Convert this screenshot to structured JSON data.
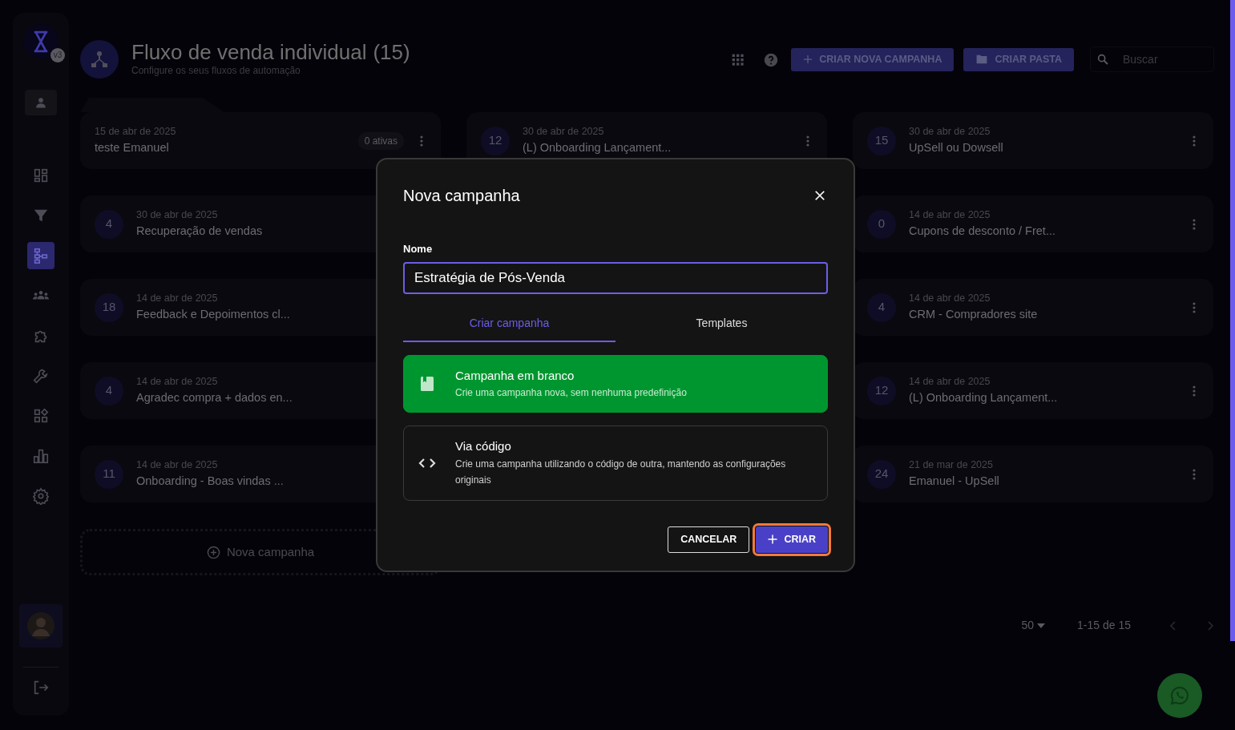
{
  "sidebar": {
    "logo_badge": "v3",
    "items": [
      {
        "selected": false
      },
      {
        "selected": false
      },
      {
        "selected": true
      },
      {
        "selected": false
      },
      {
        "selected": false
      },
      {
        "selected": false
      },
      {
        "selected": false
      },
      {
        "selected": false
      },
      {
        "selected": false
      }
    ]
  },
  "header": {
    "title": "Fluxo de venda individual",
    "count": "(15)",
    "subtitle": "Configure os seus fluxos de automação"
  },
  "toolbar": {
    "buttons": [
      {
        "kind": "create",
        "label": "CRIAR NOVA CAMPANHA"
      },
      {
        "kind": "folder",
        "label": "CRIAR PASTA"
      }
    ],
    "search": {
      "placeholder": "Buscar"
    }
  },
  "columns": [
    {
      "cards": [
        {
          "kind": "folder",
          "date": "15 de abr de 2025",
          "title": "teste Emanuel",
          "badge": "0 ativas",
          "menu": true
        },
        {
          "kind": "campaign",
          "count": "4",
          "date": "30 de abr de 2025",
          "title": "Recuperação de vendas"
        },
        {
          "kind": "campaign",
          "count": "18",
          "date": "14 de abr de 2025",
          "title": "Feedback e Depoimentos cl..."
        },
        {
          "kind": "campaign",
          "count": "4",
          "date": "14 de abr de 2025",
          "title": "Agradec compra + dados en..."
        },
        {
          "kind": "campaign",
          "count": "11",
          "date": "14 de abr de 2025",
          "title": "Onboarding - Boas vindas ..."
        }
      ]
    },
    {
      "cards": [
        {
          "kind": "campaign",
          "count": "12",
          "date": "30 de abr de 2025",
          "title": "(L) Onboarding Lançament...",
          "menu": true
        }
      ]
    },
    {
      "cards": [
        {
          "kind": "campaign",
          "count": "15",
          "date": "30 de abr de 2025",
          "title": "UpSell ou Dowsell",
          "menu": true
        },
        {
          "kind": "campaign",
          "count": "0",
          "date": "14 de abr de 2025",
          "title": "Cupons de desconto / Fret...",
          "menu": true
        },
        {
          "kind": "campaign",
          "count": "4",
          "date": "14 de abr de 2025",
          "title": "CRM - Compradores site",
          "menu": true
        },
        {
          "kind": "campaign",
          "count": "12",
          "date": "14 de abr de 2025",
          "title": "(L) Onboarding Lançament...",
          "menu": true
        },
        {
          "kind": "campaign",
          "count": "24",
          "date": "21 de mar de 2025",
          "title": "Emanuel - UpSell",
          "menu": true
        }
      ]
    }
  ],
  "new_campaign": "Nova campanha",
  "pagination": {
    "page_size": "50",
    "range": "1-15 de 15"
  },
  "modal": {
    "title": "Nova campanha",
    "field": {
      "label": "Nome",
      "value": "Estratégia de Pós-Venda"
    },
    "tabs": [
      {
        "label": "Criar campanha",
        "selected": true
      },
      {
        "label": "Templates",
        "selected": false
      }
    ],
    "options": [
      {
        "kind": "blank",
        "title": "Campanha em branco",
        "description": "Crie uma campanha nova, sem nenhuma predefinição",
        "selected": true
      },
      {
        "kind": "code",
        "title": "Via código",
        "description": "Crie uma campanha utilizando o código de outra, mantendo as configurações originais",
        "selected": false
      }
    ],
    "buttons": [
      {
        "kind": "outline",
        "label": "CANCELAR",
        "focused": false
      },
      {
        "kind": "primary",
        "label": "CRIAR",
        "focused": true
      }
    ]
  }
}
